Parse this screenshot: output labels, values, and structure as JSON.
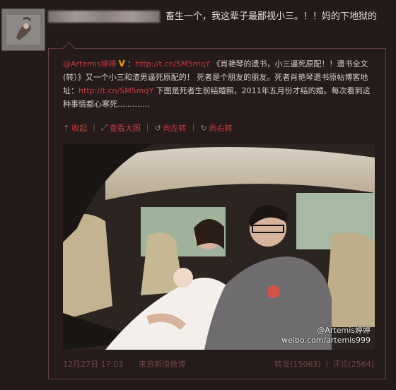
{
  "post": {
    "text": "畜生一个，我这辈子最鄙视小三。！！妈的下地狱的"
  },
  "repost": {
    "author": "@Artemis婷婷",
    "colon": "：",
    "link1": "http://t.cn/SM5mqY",
    "body1": "《肖艳琴的遗书，小三逼死原配！！遗书全文(转）》又一个小三和渣男逼死原配的！ 死者是个朋友的朋友。死者肖艳琴遗书原帖博客地址：",
    "link2": "http://t.cn/SM5mqY",
    "body2": "下图是死者生前结婚照，2011年五月份才结的婚。每次看到这种事情都心寒死.............",
    "actions": [
      {
        "icon": "arrow-up-icon",
        "label": "收起"
      },
      {
        "icon": "expand-icon",
        "label": "查看大图"
      },
      {
        "icon": "rotate-left-icon",
        "label": "向左转"
      },
      {
        "icon": "rotate-right-icon",
        "label": "向右转"
      }
    ],
    "watermark_handle": "@Artemis婷婷",
    "watermark_url": "weibo.com/artemis999",
    "time": "12月27日 17:03",
    "source_prefix": "来自",
    "source": "新浪微博",
    "repost_label": "转发(15063)",
    "divider": "|",
    "comment_label": "评论(2564)"
  },
  "colors": {
    "background": "#241a1a",
    "link": "#c83b3b",
    "border": "#6b4040",
    "vip": "#f2a100"
  }
}
